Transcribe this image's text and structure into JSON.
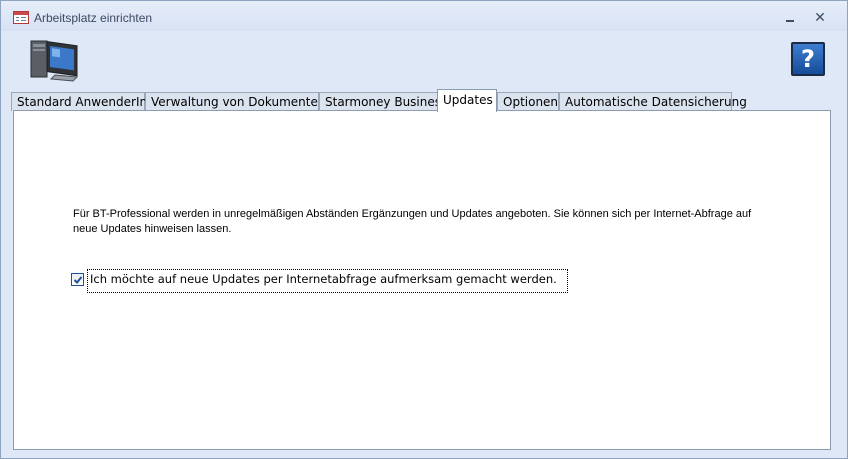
{
  "window": {
    "title": "Arbeitsplatz einrichten",
    "controls": {
      "minimize": "–",
      "close": "✕"
    }
  },
  "help": {
    "label": "?"
  },
  "tabs": [
    {
      "label": "Standard AnwenderIn",
      "active": false
    },
    {
      "label": "Verwaltung von Dokumenten",
      "active": false
    },
    {
      "label": "Starmoney Business",
      "active": false
    },
    {
      "label": "Updates",
      "active": true
    },
    {
      "label": "Optionen",
      "active": false
    },
    {
      "label": "Automatische Datensicherung",
      "active": false
    }
  ],
  "updates": {
    "info_line1": "Für BT-Professional werden in unregelmäßigen Abständen Ergänzungen und Updates angeboten. Sie können sich per Internet-Abfrage auf",
    "info_line2": "neue Updates hinweisen lassen.",
    "checkbox_label": "Ich möchte auf neue Updates per Internetabfrage aufmerksam gemacht werden.",
    "checkbox_checked": true
  },
  "colors": {
    "window_bg": "#dfe8f6",
    "help_bg": "#2a63b4",
    "checkmark": "#1e4f9a"
  },
  "icons": [
    "form-icon",
    "computer-icon",
    "help-icon",
    "check-icon"
  ]
}
